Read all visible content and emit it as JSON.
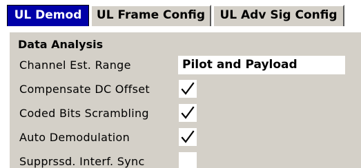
{
  "tabs": [
    {
      "label": "UL Demod",
      "active": true
    },
    {
      "label": "UL Frame Config",
      "active": false
    },
    {
      "label": "UL Adv Sig Config",
      "active": false
    }
  ],
  "panel": {
    "section_title": "Data Analysis",
    "channel_est": {
      "label": "Channel Est. Range",
      "value": "Pilot and Payload"
    },
    "compensate_dc": {
      "label": "Compensate DC Offset",
      "checked": true
    },
    "coded_bits": {
      "label": "Coded Bits Scrambling",
      "checked": true
    },
    "auto_demod": {
      "label": "Auto Demodulation",
      "checked": true
    },
    "suppressed_interf": {
      "label": "Supprssd. Interf. Sync",
      "checked": false
    }
  },
  "colors": {
    "active_tab_bg": "#0000a8",
    "panel_bg": "#d4d0c8"
  }
}
